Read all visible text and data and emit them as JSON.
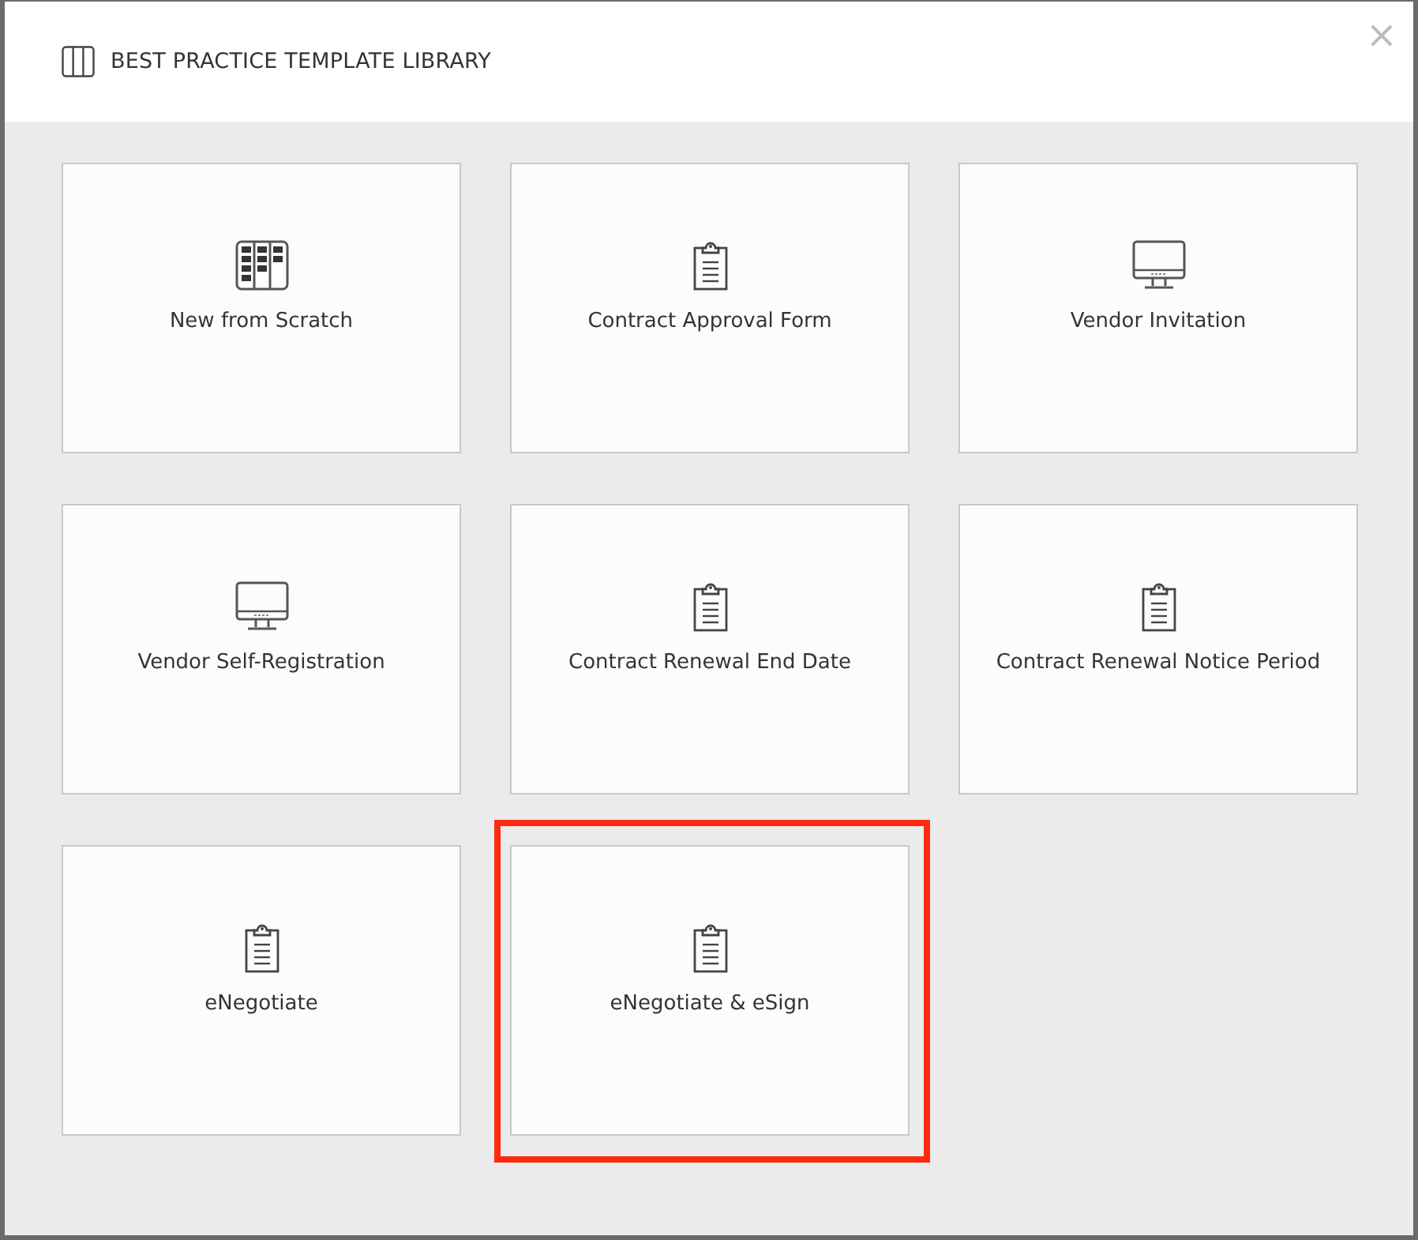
{
  "dialog": {
    "title": "BEST PRACTICE TEMPLATE LIBRARY",
    "close": "×"
  },
  "tiles": [
    {
      "label": "New from Scratch",
      "kind": "board",
      "highlighted": false
    },
    {
      "label": "Contract Approval Form",
      "kind": "clipboard",
      "highlighted": false
    },
    {
      "label": "Vendor Invitation",
      "kind": "monitor",
      "highlighted": false
    },
    {
      "label": "Vendor Self-Registration",
      "kind": "monitor",
      "highlighted": false
    },
    {
      "label": "Contract Renewal End Date",
      "kind": "clipboard",
      "highlighted": false
    },
    {
      "label": "Contract Renewal Notice Period",
      "kind": "clipboard",
      "highlighted": false
    },
    {
      "label": "eNegotiate",
      "kind": "clipboard",
      "highlighted": false
    },
    {
      "label": "eNegotiate & eSign",
      "kind": "clipboard",
      "highlighted": true
    }
  ]
}
